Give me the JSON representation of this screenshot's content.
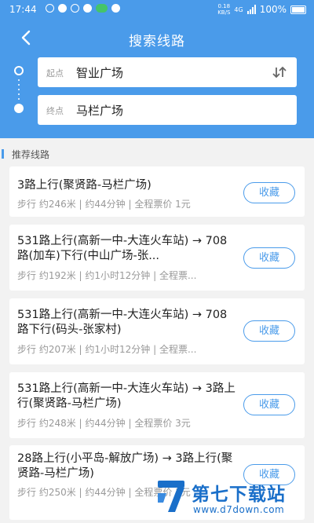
{
  "status_bar": {
    "time": "17:44",
    "speed_top": "0.18",
    "speed_bottom": "KB/S",
    "network": "4G",
    "battery": "100%"
  },
  "nav": {
    "title": "搜索线路"
  },
  "search": {
    "start_label": "起点",
    "start_value": "智业广场",
    "end_label": "终点",
    "end_value": "马栏广场"
  },
  "section": {
    "title": "推荐线路"
  },
  "routes": [
    {
      "title": "3路上行(聚贤路-马栏广场)",
      "meta": "步行 约246米 | 约44分钟 | 全程票价 1元",
      "fav_label": "收藏"
    },
    {
      "title": "531路上行(高新一中-大连火车站) → 708路(加车)下行(中山广场-张...",
      "meta": "步行 约192米 | 约1小时12分钟 | 全程票...",
      "fav_label": "收藏"
    },
    {
      "title": "531路上行(高新一中-大连火车站) → 708路下行(码头-张家村)",
      "meta": "步行 约207米 | 约1小时12分钟 | 全程票...",
      "fav_label": "收藏"
    },
    {
      "title": "531路上行(高新一中-大连火车站) → 3路上行(聚贤路-马栏广场)",
      "meta": "步行 约248米 | 约44分钟 | 全程票价 3元",
      "fav_label": "收藏"
    },
    {
      "title": "28路上行(小平岛-解放广场) → 3路上行(聚贤路-马栏广场)",
      "meta": "步行 约250米 | 约44分钟 | 全程票价 3元",
      "fav_label": "收藏"
    }
  ],
  "watermark": {
    "name": "第七下载站",
    "url": "www.d7down.com"
  },
  "colors": {
    "primary": "#4a9bea",
    "background": "#f2f2f2",
    "watermark": "#1a6fc9"
  }
}
